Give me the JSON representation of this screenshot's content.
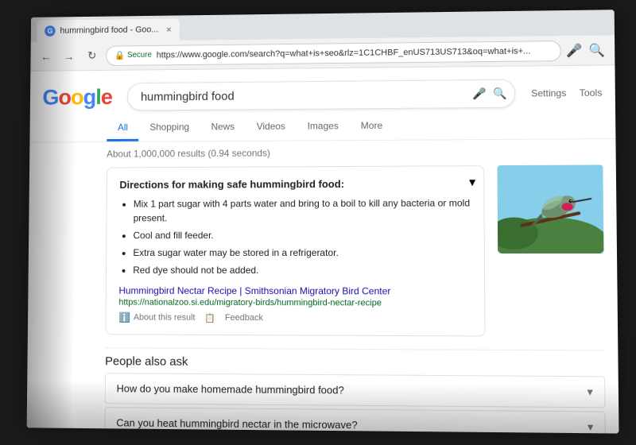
{
  "browser": {
    "tab": {
      "title": "hummingbird food - Goo...",
      "favicon": "G"
    },
    "address_bar": {
      "secure_label": "Secure",
      "url": "https://www.google.com/search?q=what+is+seo&rlz=1C1CHBF_enUS713US713&oq=what+is+..."
    },
    "nav": {
      "back": "←",
      "forward": "→",
      "refresh": "↻"
    }
  },
  "google": {
    "logo": "Google",
    "search_query": "hummingbird food",
    "header_links": {
      "settings": "Settings",
      "tools": "Tools"
    },
    "tabs": [
      {
        "label": "All",
        "active": true
      },
      {
        "label": "Shopping",
        "active": false
      },
      {
        "label": "News",
        "active": false
      },
      {
        "label": "Videos",
        "active": false
      },
      {
        "label": "Images",
        "active": false
      },
      {
        "label": "More",
        "active": false
      }
    ],
    "results_count": "About 1,000,000 results (0.94 seconds)",
    "featured_snippet": {
      "title": "Directions for making safe hummingbird food:",
      "items": [
        "Mix 1 part sugar with 4 parts water and bring to a boil to kill any bacteria or mold present.",
        "Cool and fill feeder.",
        "Extra sugar water may be stored in a refrigerator.",
        "Red dye should not be added."
      ],
      "source_text": "Hummingbird Nectar Recipe | Smithsonian Migratory Bird Center",
      "source_url": "https://nationalzoo.si.edu/migratory-birds/hummingbird-nectar-recipe",
      "about_label": "About this result",
      "feedback_label": "Feedback"
    },
    "people_also_ask": {
      "title": "People also ask",
      "items": [
        "How do you make homemade hummingbird food?",
        "Can you heat hummingbird nectar in the microwave?"
      ]
    }
  }
}
